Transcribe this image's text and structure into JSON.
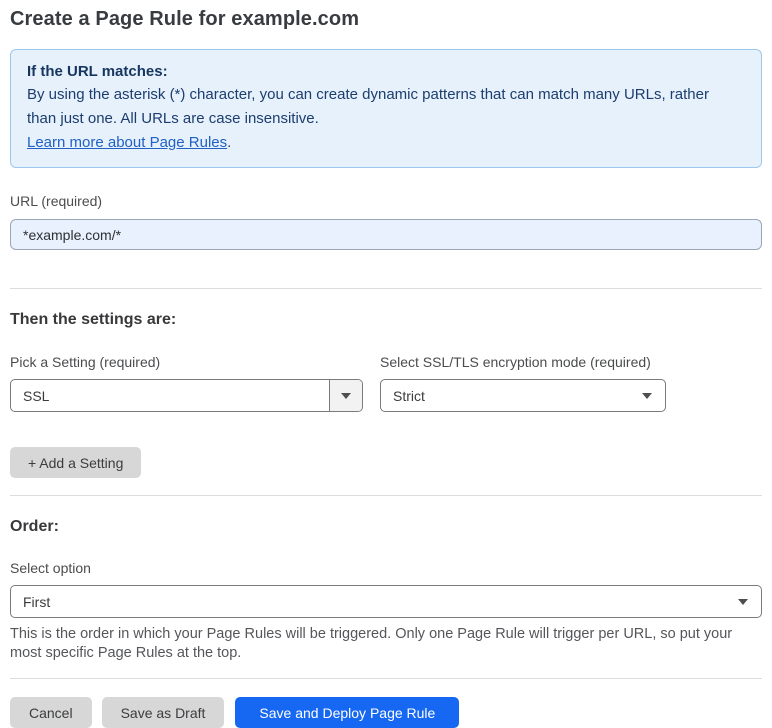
{
  "page": {
    "title": "Create a Page Rule for example.com"
  },
  "info_box": {
    "heading": "If the URL matches:",
    "body": "By using the asterisk (*) character, you can create dynamic patterns that can match many URLs, rather than just one. All URLs are case insensitive.",
    "link_text": "Learn more about Page Rules",
    "link_suffix": "."
  },
  "url_field": {
    "label": "URL (required)",
    "value": "*example.com/*"
  },
  "settings_section": {
    "heading": "Then the settings are:",
    "setting_select": {
      "label": "Pick a Setting (required)",
      "value": "SSL"
    },
    "mode_select": {
      "label": "Select SSL/TLS encryption mode (required)",
      "value": "Strict"
    },
    "add_setting_label": "+ Add a Setting"
  },
  "order_section": {
    "heading": "Order:",
    "select_label": "Select option",
    "select_value": "First",
    "help_text": "This is the order in which your Page Rules will be triggered. Only one Page Rule will trigger per URL, so put your most specific Page Rules at the top."
  },
  "footer": {
    "cancel_label": "Cancel",
    "save_draft_label": "Save as Draft",
    "save_deploy_label": "Save and Deploy Page Rule"
  },
  "icons": {
    "dropdown_arrow": "caret-down-triangle"
  },
  "colors": {
    "accent_blue": "#1667f2",
    "info_box_bg": "#e6f1fc",
    "info_box_border": "#9ec7ee",
    "info_text": "#1c3d6e",
    "link_blue": "#2160c4",
    "url_input_bg": "#e8f1fd",
    "gray_button_bg": "#d7d7d7",
    "divider": "#dcdcdc"
  }
}
